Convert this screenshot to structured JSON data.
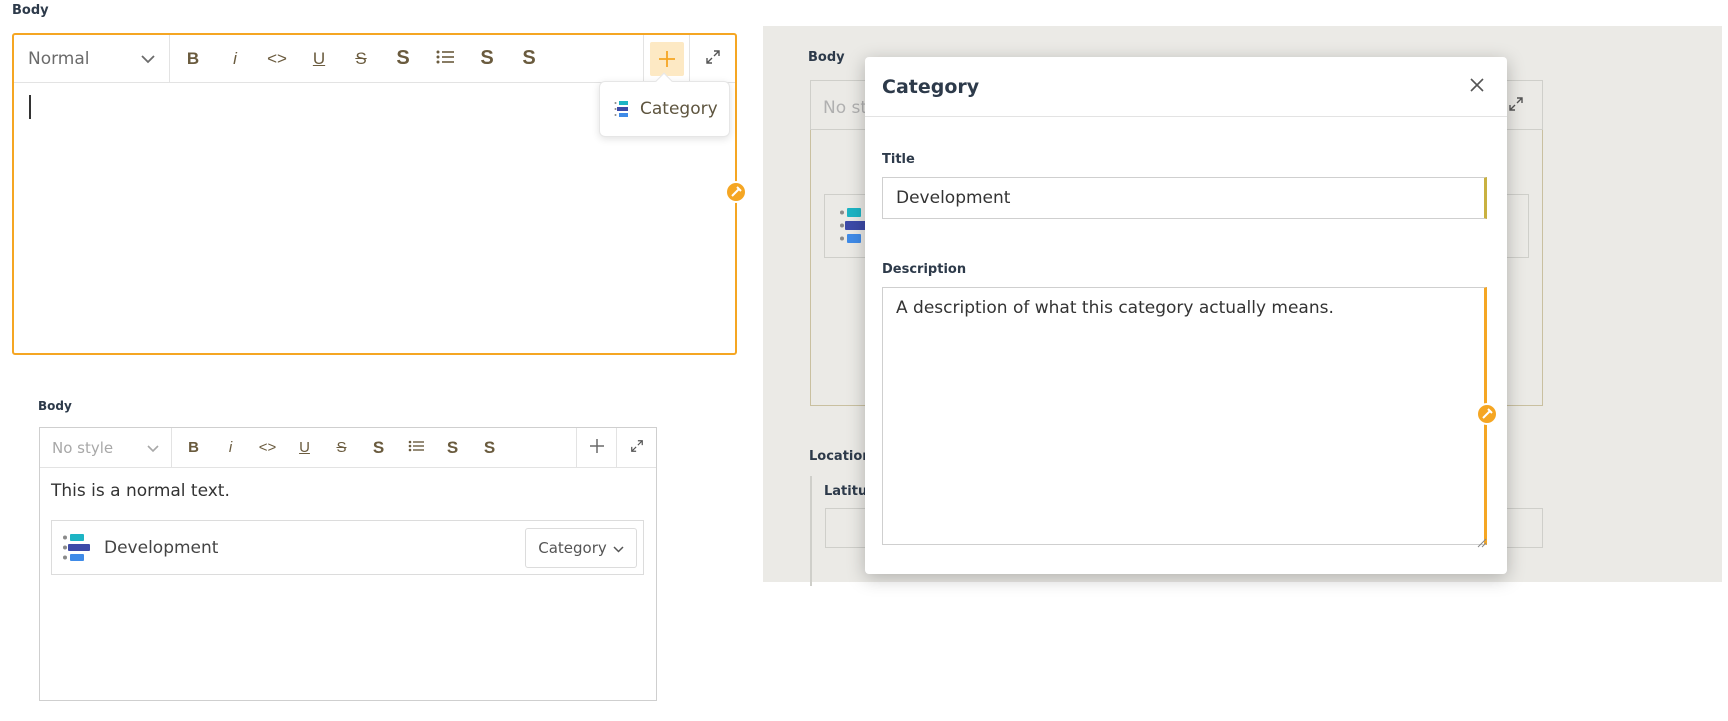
{
  "editor1": {
    "label": "Body",
    "style_value": "Normal",
    "toolbar": {
      "bold": "B",
      "italic": "i",
      "code": "<>",
      "underline": "U",
      "strike": "S",
      "s1": "S",
      "s2": "S",
      "s3": "S"
    },
    "popover_item": "Category"
  },
  "editor2": {
    "label": "Body",
    "style_placeholder": "No style",
    "toolbar": {
      "bold": "B",
      "italic": "i",
      "code": "<>",
      "underline": "U",
      "strike": "S",
      "s1": "S",
      "s2": "S",
      "s3": "S"
    },
    "text": "This is a normal text.",
    "category_card": {
      "name": "Development",
      "dropdown_label": "Category"
    }
  },
  "background_panel": {
    "body_label": "Body",
    "style_placeholder_partial": "No st",
    "location_label": "Location",
    "latitude_partial": "Latitu"
  },
  "modal": {
    "title": "Category",
    "title_field": {
      "label": "Title",
      "value": "Development"
    },
    "description_field": {
      "label": "Description",
      "value": "A description of what this category actually means."
    }
  },
  "colors": {
    "accent": "#f5a623",
    "accent_light": "#fde9c4",
    "category_teal": "#1db4c4",
    "category_navy": "#3c4aa8",
    "category_blue": "#3f8be8"
  }
}
